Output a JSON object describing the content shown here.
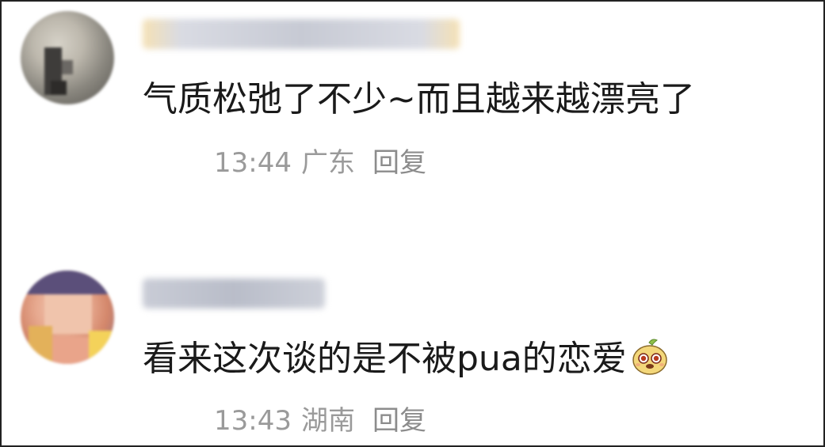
{
  "comments": [
    {
      "text": "气质松弛了不少~而且越来越漂亮了",
      "time": "13:44",
      "location": "广东",
      "reply_label": "回复"
    },
    {
      "text": "看来这次谈的是不被pua的恋爱",
      "time": "13:43",
      "location": "湖南",
      "reply_label": "回复",
      "emoji": "cute-animal-emoji"
    }
  ],
  "colors": {
    "text": "#1a1a1a",
    "meta": "#9a9a9a",
    "border": "#222222"
  }
}
